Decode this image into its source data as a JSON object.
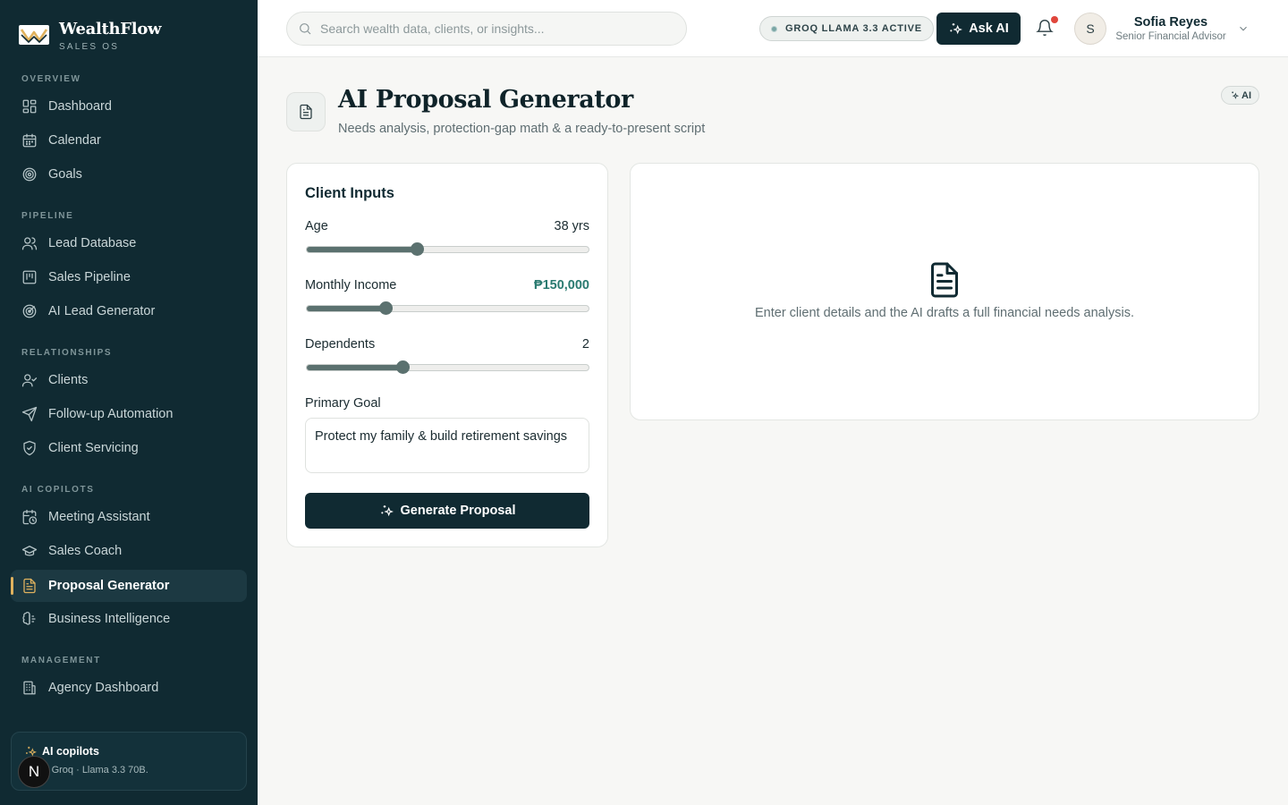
{
  "brand": {
    "name": "WealthFlow",
    "subtitle": "SALES OS"
  },
  "sidebar": {
    "sections": [
      {
        "label": "OVERVIEW",
        "items": [
          {
            "label": "Dashboard",
            "icon": "grid-icon"
          },
          {
            "label": "Calendar",
            "icon": "calendar-icon"
          },
          {
            "label": "Goals",
            "icon": "target-icon"
          }
        ]
      },
      {
        "label": "PIPELINE",
        "items": [
          {
            "label": "Lead Database",
            "icon": "users-icon"
          },
          {
            "label": "Sales Pipeline",
            "icon": "kanban-icon"
          },
          {
            "label": "AI Lead Generator",
            "icon": "radar-icon"
          }
        ]
      },
      {
        "label": "RELATIONSHIPS",
        "items": [
          {
            "label": "Clients",
            "icon": "user-check-icon"
          },
          {
            "label": "Follow-up Automation",
            "icon": "send-icon"
          },
          {
            "label": "Client Servicing",
            "icon": "shield-icon"
          }
        ]
      },
      {
        "label": "AI COPILOTS",
        "items": [
          {
            "label": "Meeting Assistant",
            "icon": "calendar-clock-icon"
          },
          {
            "label": "Sales Coach",
            "icon": "graduation-cap-icon"
          },
          {
            "label": "Proposal Generator",
            "icon": "file-text-icon",
            "active": true
          },
          {
            "label": "Business Intelligence",
            "icon": "brain-icon"
          }
        ]
      },
      {
        "label": "MANAGEMENT",
        "items": [
          {
            "label": "Agency Dashboard",
            "icon": "building-icon"
          }
        ]
      }
    ],
    "copilot_card": {
      "title": "AI copilots",
      "subtitle": "ng on Groq · Llama 3.3 70B."
    },
    "badge_letter": "N"
  },
  "topbar": {
    "search_placeholder": "Search wealth data, clients, or insights...",
    "model_status": "GROQ LLAMA 3.3 ACTIVE",
    "ask_ai_label": "Ask AI",
    "user": {
      "initial": "S",
      "name": "Sofia Reyes",
      "role": "Senior Financial Advisor"
    }
  },
  "page": {
    "title": "AI Proposal Generator",
    "subtitle": "Needs analysis, protection-gap math & a ready-to-present script",
    "ai_chip": "AI"
  },
  "inputs": {
    "title": "Client Inputs",
    "age": {
      "label": "Age",
      "value": "38 yrs",
      "fraction": 0.39
    },
    "income": {
      "label": "Monthly Income",
      "value": "₱150,000",
      "fraction": 0.28
    },
    "dependents": {
      "label": "Dependents",
      "value": "2",
      "fraction": 0.34
    },
    "goal": {
      "label": "Primary Goal",
      "value": "Protect my family & build retirement savings"
    },
    "generate_label": "Generate Proposal"
  },
  "output": {
    "empty_text": "Enter client details and the AI drafts a full financial needs analysis."
  },
  "colors": {
    "sidebar_bg": "#102a32",
    "accent_gold": "#e0b25e",
    "accent_teal": "#2a7a70",
    "notification": "#e0463c"
  }
}
